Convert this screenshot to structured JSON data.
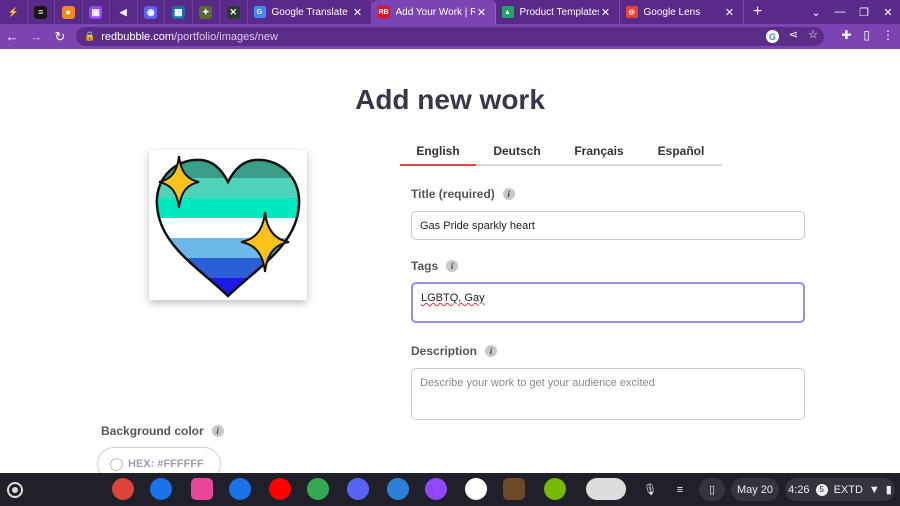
{
  "browser": {
    "pinned_tabs": [
      {
        "icon": "lightning-icon",
        "color": "#5a2a8a",
        "glyph": "⚡"
      },
      {
        "icon": "spotify-icon",
        "color": "#191414",
        "glyph": "≡"
      },
      {
        "icon": "pumpkin-icon",
        "color": "#f08a24",
        "glyph": "●"
      },
      {
        "icon": "twitch-icon",
        "color": "#9146ff",
        "glyph": "▣"
      },
      {
        "icon": "speaker-icon",
        "color": "#5a2a8a",
        "glyph": "◀"
      },
      {
        "icon": "discord-icon",
        "color": "#5865f2",
        "glyph": "◉"
      },
      {
        "icon": "grid-app-icon",
        "color": "#1a6fb0",
        "glyph": "▦"
      },
      {
        "icon": "game-icon",
        "color": "#556b2f",
        "glyph": "✦"
      },
      {
        "icon": "x-app-icon",
        "color": "#2b3b2b",
        "glyph": "✕"
      }
    ],
    "tabs": [
      {
        "title": "Google Translate",
        "color": "#4285f4",
        "glyph": "G"
      },
      {
        "title": "Add Your Work | Redb",
        "color": "#e41321",
        "glyph": "RB"
      },
      {
        "title": "Product Templates",
        "color": "#1fa463",
        "glyph": "▲"
      },
      {
        "title": "Google Lens",
        "color": "#ea4335",
        "glyph": "◎"
      }
    ],
    "new_tab_glyph": "+",
    "url_host": "redbubble.com",
    "url_path": "/portfolio/images/new"
  },
  "page": {
    "title": "Add new work",
    "languages": [
      "English",
      "Deutsch",
      "Français",
      "Español"
    ],
    "active_language": "English",
    "title_label": "Title (required)",
    "title_value": "Gas Pride sparkly heart",
    "tags_label": "Tags",
    "tags_value": "LGBTQ, Gay",
    "description_label": "Description",
    "description_placeholder": "Describe your work to get your audience excited",
    "background_label": "Background color",
    "hex_label": "HEX: #FFFFFF",
    "info_glyph": "i"
  },
  "artwork": {
    "stripe_colors": [
      "#3a9e8a",
      "#4fd3b8",
      "#00e8c0",
      "#ffffff",
      "#6cb8e6",
      "#2a5fd6",
      "#1c1ae8"
    ],
    "sparkle_color": "#ffc21a"
  },
  "shelf": {
    "date": "May 20",
    "time": "4:26",
    "notif_count": "5",
    "network": "EXTD",
    "apps": [
      {
        "name": "chrome-app",
        "color": "#db4437"
      },
      {
        "name": "files-app",
        "color": "#1a73e8"
      },
      {
        "name": "gallery-app",
        "color": "#e8459b"
      },
      {
        "name": "messages-app",
        "color": "#1a73e8"
      },
      {
        "name": "youtube-app",
        "color": "#ff0000"
      },
      {
        "name": "play-store-app",
        "color": "#34a853"
      },
      {
        "name": "discord-app",
        "color": "#5865f2"
      },
      {
        "name": "ibis-paint-app",
        "color": "#2d7fd8"
      },
      {
        "name": "twitch-app",
        "color": "#9146ff"
      },
      {
        "name": "capcut-app",
        "color": "#ffffff"
      },
      {
        "name": "minecraft-app",
        "color": "#6b4a2a"
      },
      {
        "name": "nvidia-app",
        "color": "#76b900"
      }
    ]
  }
}
